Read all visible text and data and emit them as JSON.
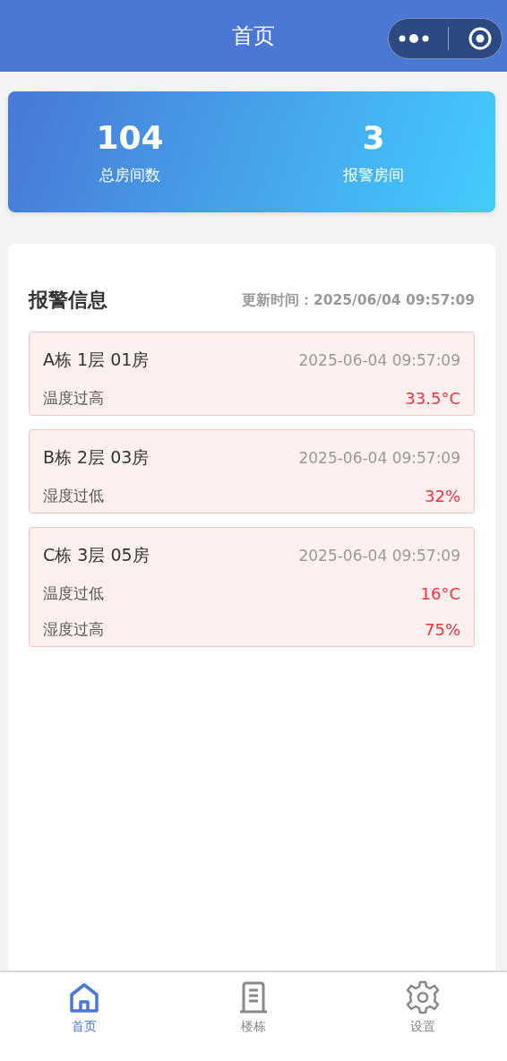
{
  "nav_bar": {
    "title": "首页"
  },
  "stats": [
    {
      "value": "104",
      "label": "总房间数"
    },
    {
      "value": "3",
      "label": "报警房间"
    }
  ],
  "alerts": {
    "title": "报警信息",
    "updated": "更新时间：2025/06/04 09:57:09",
    "items": [
      {
        "room": "A栋 1层 01房",
        "time": "2025-06-04 09:57:09",
        "readings": [
          {
            "label": "温度过高",
            "value": "33.5°C"
          }
        ]
      },
      {
        "room": "B栋 2层 03房",
        "time": "2025-06-04 09:57:09",
        "readings": [
          {
            "label": "湿度过低",
            "value": "32%"
          }
        ]
      },
      {
        "room": "C栋 3层 05房",
        "time": "2025-06-04 09:57:09",
        "readings": [
          {
            "label": "温度过低",
            "value": "16°C"
          },
          {
            "label": "湿度过高",
            "value": "75%"
          }
        ]
      }
    ]
  },
  "tab_bar": [
    {
      "kind": "home",
      "label": "首页",
      "selected": true
    },
    {
      "kind": "building",
      "label": "楼栋",
      "selected": false
    },
    {
      "kind": "settings",
      "label": "设置",
      "selected": false
    }
  ]
}
